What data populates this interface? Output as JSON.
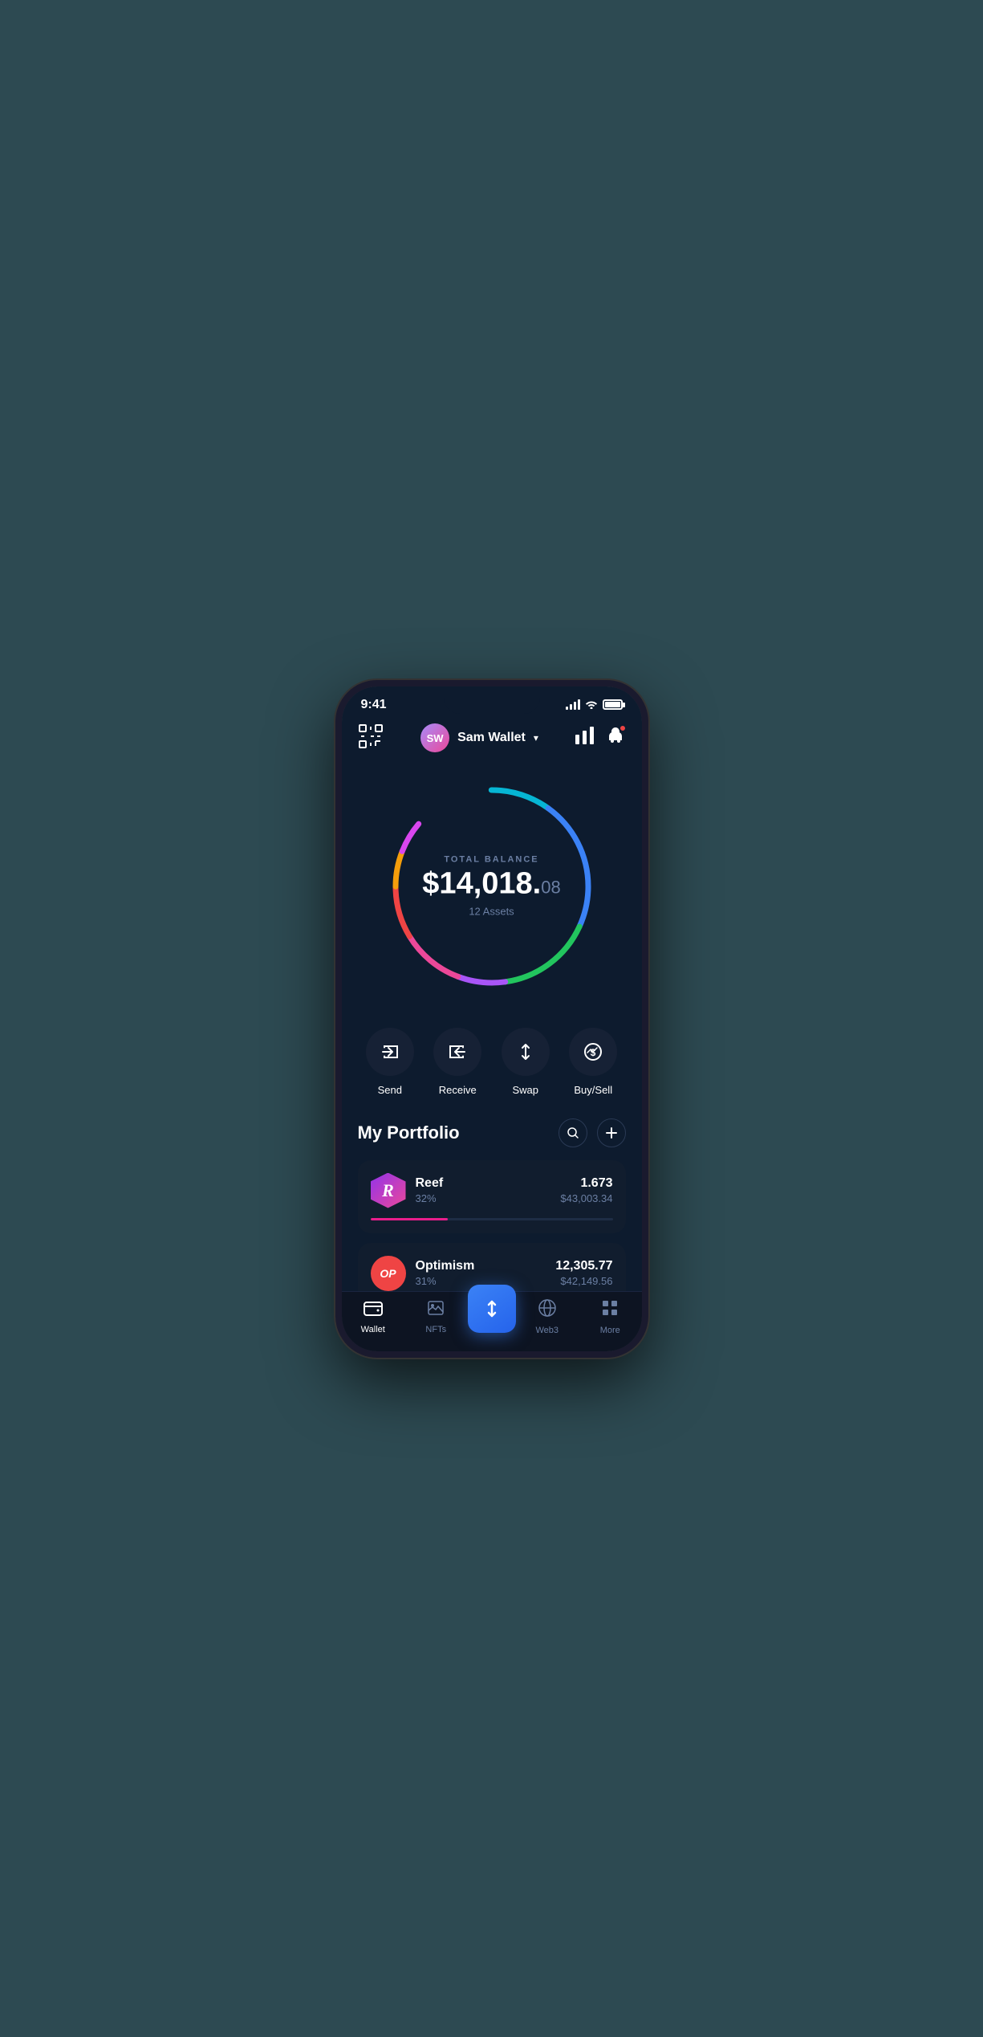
{
  "status": {
    "time": "9:41",
    "signal_bars": [
      4,
      7,
      10,
      13
    ],
    "battery_pct": 100
  },
  "header": {
    "username": "Sam Wallet",
    "avatar_initials": "SW",
    "scan_label": "scan",
    "chart_label": "chart",
    "bell_label": "notifications"
  },
  "balance": {
    "label": "TOTAL BALANCE",
    "whole": "$14,018.",
    "cents": "08",
    "assets_label": "12 Assets"
  },
  "actions": [
    {
      "id": "send",
      "label": "Send",
      "icon": "→"
    },
    {
      "id": "receive",
      "label": "Receive",
      "icon": "←"
    },
    {
      "id": "swap",
      "label": "Swap",
      "icon": "⇅"
    },
    {
      "id": "buysell",
      "label": "Buy/Sell",
      "icon": "$"
    }
  ],
  "portfolio": {
    "title": "My Portfolio",
    "search_label": "search",
    "add_label": "add",
    "assets": [
      {
        "id": "reef",
        "name": "Reef",
        "pct": "32%",
        "amount": "1.673",
        "value": "$43,003.34",
        "bar_color": "#e91e8c",
        "bar_width": "32",
        "logo_text": "R",
        "logo_type": "reef"
      },
      {
        "id": "optimism",
        "name": "Optimism",
        "pct": "31%",
        "amount": "12,305.77",
        "value": "$42,149.56",
        "bar_color": "#ef4444",
        "bar_width": "31",
        "logo_text": "OP",
        "logo_type": "op"
      }
    ]
  },
  "nav": {
    "items": [
      {
        "id": "wallet",
        "label": "Wallet",
        "icon": "💳",
        "active": true
      },
      {
        "id": "nfts",
        "label": "NFTs",
        "icon": "🖼",
        "active": false
      },
      {
        "id": "web3",
        "label": "Web3",
        "icon": "🌐",
        "active": false
      },
      {
        "id": "more",
        "label": "More",
        "icon": "⊞",
        "active": false
      }
    ],
    "center_icon": "⇅"
  },
  "ring": {
    "segments": [
      {
        "color": "#06b6d4",
        "pct": 18
      },
      {
        "color": "#3b82f6",
        "pct": 22
      },
      {
        "color": "#22c55e",
        "pct": 15
      },
      {
        "color": "#a855f7",
        "pct": 10
      },
      {
        "color": "#ec4899",
        "pct": 12
      },
      {
        "color": "#ef4444",
        "pct": 10
      },
      {
        "color": "#f59e0b",
        "pct": 7
      },
      {
        "color": "#d946ef",
        "pct": 6
      }
    ]
  }
}
